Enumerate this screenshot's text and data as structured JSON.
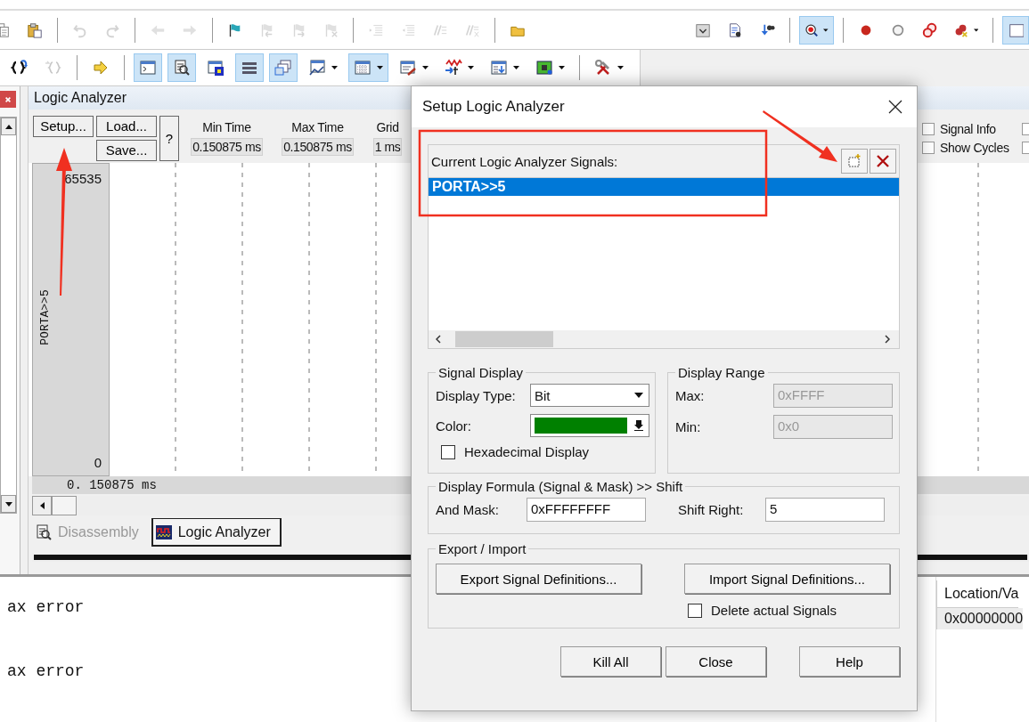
{
  "toolbars": [
    [
      {
        "pressed": false,
        "disabled": false
      },
      {
        "pressed": false,
        "disabled": false
      },
      {
        "pressed": false,
        "disabled": true
      },
      {
        "pressed": false,
        "disabled": true
      },
      {
        "pressed": false,
        "disabled": true
      },
      {
        "pressed": false,
        "disabled": true
      },
      {
        "pressed": false,
        "disabled": false
      },
      {
        "pressed": false,
        "disabled": true
      },
      {
        "pressed": false,
        "disabled": true
      },
      {
        "pressed": false,
        "disabled": true
      },
      {
        "pressed": false,
        "disabled": true
      },
      {
        "pressed": false,
        "disabled": true
      },
      {
        "pressed": false,
        "disabled": true
      },
      {
        "pressed": false,
        "disabled": true
      },
      {
        "pressed": false,
        "disabled": false
      },
      {
        "pressed": false,
        "disabled": false
      },
      {
        "pressed": false,
        "disabled": false
      },
      {
        "pressed": false,
        "disabled": false
      },
      {
        "pressed": true,
        "disabled": false
      },
      {
        "pressed": false,
        "disabled": false
      },
      {
        "pressed": false,
        "disabled": false
      },
      {
        "pressed": false,
        "disabled": false
      },
      {
        "pressed": false,
        "disabled": false
      },
      {
        "pressed": true,
        "disabled": false
      }
    ],
    [
      {
        "pressed": false,
        "disabled": false
      },
      {
        "pressed": false,
        "disabled": true
      },
      {
        "pressed": false,
        "disabled": false
      },
      {
        "pressed": true,
        "disabled": false
      },
      {
        "pressed": true,
        "disabled": false
      },
      {
        "pressed": false,
        "disabled": false
      },
      {
        "pressed": true,
        "disabled": false
      },
      {
        "pressed": true,
        "disabled": false
      },
      {
        "pressed": false,
        "disabled": false
      },
      {
        "pressed": true,
        "disabled": false
      },
      {
        "pressed": false,
        "disabled": false
      },
      {
        "pressed": false,
        "disabled": false
      },
      {
        "pressed": false,
        "disabled": false
      },
      {
        "pressed": false,
        "disabled": false
      },
      {
        "pressed": false,
        "disabled": false
      }
    ]
  ],
  "logic_analyzer": {
    "title": "Logic Analyzer",
    "buttons": [
      "Setup...",
      "Load...",
      "Save...",
      "?"
    ],
    "fields": [
      {
        "label": "Min Time",
        "value": "0.150875 ms"
      },
      {
        "label": "Max Time",
        "value": "0.150875 ms"
      },
      {
        "label": "Grid",
        "value": "1 ms"
      }
    ],
    "options": [
      {
        "label": "Signal Info",
        "checked": false,
        "next_checked": false
      },
      {
        "label": "Show Cycles",
        "checked": false,
        "next_checked": false
      }
    ],
    "axis_max": "65535",
    "signal_name": "PORTA>>5",
    "axis_min": "0",
    "cursor_time": "0. 150875 ms",
    "tabs": [
      {
        "label": "Disassembly",
        "selected": false
      },
      {
        "label": "Logic Analyzer",
        "selected": true
      }
    ]
  },
  "command_window": {
    "lines": [
      "ax error",
      "ax error"
    ]
  },
  "watch": {
    "columns": [
      "Location/Va"
    ],
    "rows": [
      [
        "0x00000000"
      ]
    ]
  },
  "dialog": {
    "title": "Setup Logic Analyzer",
    "signals_label": "Current Logic Analyzer Signals:",
    "signals": [
      {
        "name": "PORTA>>5",
        "selected": true
      }
    ],
    "signal_display": {
      "title": "Signal Display",
      "display_type_label": "Display Type:",
      "display_type": "Bit",
      "color_label": "Color:",
      "color": "#008000",
      "hex_label": "Hexadecimal Display",
      "hex_checked": false
    },
    "display_range": {
      "title": "Display Range",
      "max_label": "Max:",
      "max": "0xFFFF",
      "min_label": "Min:",
      "min": "0x0",
      "disabled": true
    },
    "formula": {
      "title": "Display Formula (Signal & Mask) >> Shift",
      "mask_label": "And Mask:",
      "mask": "0xFFFFFFFF",
      "shift_label": "Shift Right:",
      "shift": "5"
    },
    "export_import": {
      "title": "Export / Import",
      "export_button": "Export Signal Definitions...",
      "import_button": "Import Signal Definitions...",
      "delete_label": "Delete actual Signals",
      "delete_checked": false
    },
    "buttons": [
      "Kill All",
      "Close",
      "Help"
    ]
  }
}
